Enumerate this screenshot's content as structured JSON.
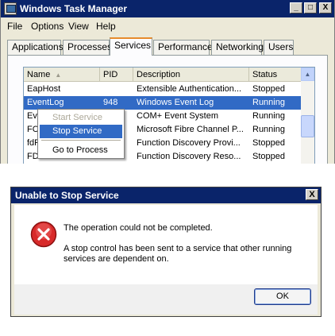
{
  "task_manager": {
    "title": "Windows Task Manager",
    "caption_buttons": {
      "minimize": "_",
      "maximize": "□",
      "close": "X"
    },
    "menu": [
      "File",
      "Options",
      "View",
      "Help"
    ],
    "tabs": [
      "Applications",
      "Processes",
      "Services",
      "Performance",
      "Networking",
      "Users"
    ],
    "active_tab": "Services",
    "columns": [
      "Name",
      "PID",
      "Description",
      "Status"
    ],
    "sort_indicator": "▲",
    "rows": [
      {
        "name": "EapHost",
        "pid": "",
        "description": "Extensible Authentication...",
        "status": "Stopped"
      },
      {
        "name": "EventLog",
        "pid": "948",
        "description": "Windows Event Log",
        "status": "Running"
      },
      {
        "name": "Ev",
        "pid": "",
        "description": "COM+ Event System",
        "status": "Running"
      },
      {
        "name": "FC",
        "pid": "",
        "description": "Microsoft Fibre Channel P...",
        "status": "Running"
      },
      {
        "name": "fdF",
        "pid": "",
        "description": "Function Discovery Provi...",
        "status": "Stopped"
      },
      {
        "name": "FD",
        "pid": "",
        "description": "Function Discovery Reso...",
        "status": "Stopped"
      }
    ],
    "context_menu": {
      "items": [
        "Start Service",
        "Stop Service",
        "Go to Process"
      ]
    },
    "scroll_up_glyph": "▲"
  },
  "dialog": {
    "title": "Unable to Stop Service",
    "close_glyph": "X",
    "message_main": "The operation could not be completed.",
    "message_detail_line1": "A stop control has been sent to a service that other running",
    "message_detail_line2": "services are dependent on.",
    "ok_label": "OK"
  },
  "colors": {
    "title_bar": "#0a246a",
    "selection": "#316ac5",
    "error_red": "#d82a2a",
    "window_face": "#ece9d8"
  }
}
